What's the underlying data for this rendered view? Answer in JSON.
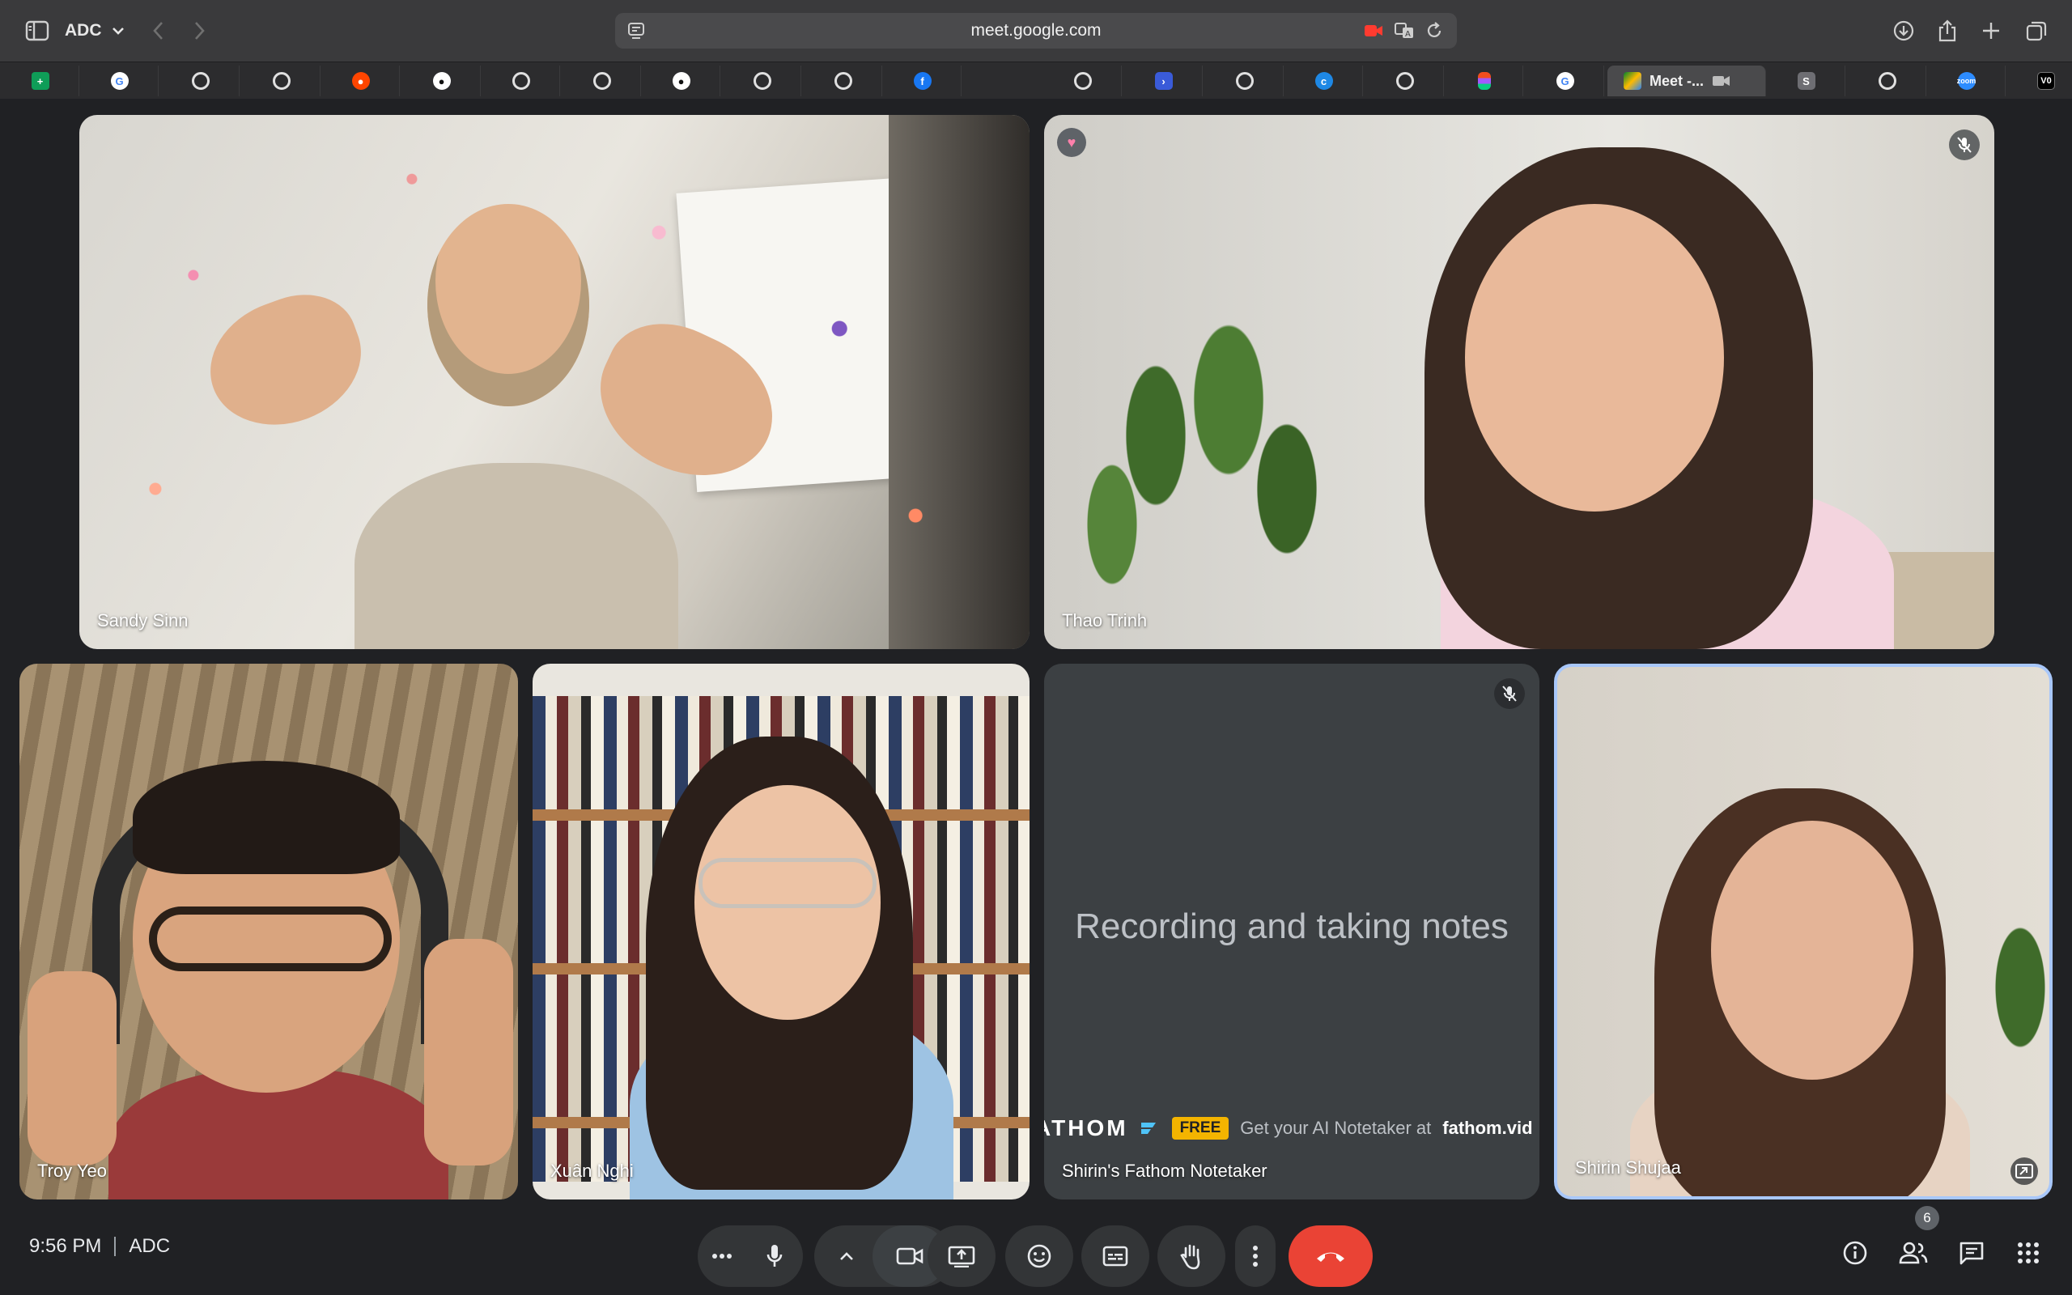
{
  "browser": {
    "profile": "ADC",
    "url": "meet.google.com",
    "active_tab_title": "Meet -..."
  },
  "tiles": [
    {
      "name": "Sandy Sinn"
    },
    {
      "name": "Thao Trinh"
    },
    {
      "name": "Troy Yeo"
    },
    {
      "name": "Xuân Nghi"
    },
    {
      "name": "Shirin's Fathom Notetaker",
      "message": "Recording and taking notes",
      "banner_brand": "ATHOM",
      "banner_free": "FREE",
      "banner_text": "Get your AI Notetaker at",
      "banner_link": "fathom.vid"
    },
    {
      "name": "Shirin Shujaa"
    }
  ],
  "controls": {
    "time": "9:56 PM",
    "meeting_code": "ADC",
    "participants_count": "6"
  },
  "colors": {
    "end_call": "#ea4335",
    "active_tile_border": "#a8c7fa",
    "fathom_free": "#f4b400"
  },
  "icons": [
    "sidebar-icon",
    "chevron-down-icon",
    "back-icon",
    "forward-icon",
    "reader-icon",
    "camera-recording-icon",
    "translate-icon",
    "reload-icon",
    "download-icon",
    "share-icon",
    "new-tab-icon",
    "tabs-overview-icon",
    "more-options-icon",
    "microphone-icon",
    "chevron-up-icon",
    "camera-icon",
    "present-icon",
    "emoji-icon",
    "captions-icon",
    "raise-hand-icon",
    "more-vert-icon",
    "hang-up-icon",
    "info-icon",
    "people-icon",
    "chat-icon",
    "activities-icon",
    "mic-off-icon",
    "pip-icon"
  ]
}
